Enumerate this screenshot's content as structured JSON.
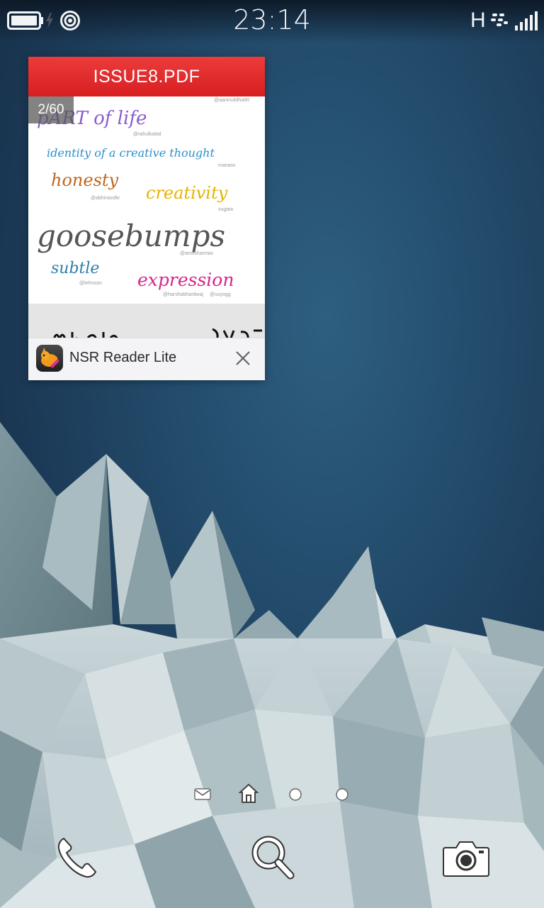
{
  "status_bar": {
    "clock": "23:14",
    "network_type": "H",
    "icons": [
      "battery-icon",
      "charging-icon",
      "hotspot-icon",
      "blackberry-icon",
      "signal-icon"
    ]
  },
  "active_frame": {
    "title": "ISSUE8.PDF",
    "page_counter": "2/60",
    "app_name": "NSR Reader Lite",
    "title_bar_color": "#e02a2b",
    "preview": {
      "words": [
        {
          "text": "pART of life",
          "color": "#8a5bd1"
        },
        {
          "text": "identity of a creative thought",
          "color": "#2a8fc9"
        },
        {
          "text": "honesty",
          "color": "#c0661a"
        },
        {
          "text": "creativity",
          "color": "#e5b400"
        },
        {
          "text": "goosebumps",
          "color": "#555555"
        },
        {
          "text": "subtle",
          "color": "#2d7ea6"
        },
        {
          "text": "expression",
          "color": "#d9248a"
        }
      ],
      "credits": [
        "@aaniruddha90",
        "@rahulkattal",
        "manasv",
        "@abhinavdkr",
        "sugata",
        "@amitsharmax",
        "@lefroson",
        "@harshabhardwaj",
        "@suyogg"
      ]
    }
  },
  "page_indicator": {
    "items": [
      "hub-icon",
      "home-icon",
      "page-dot",
      "page-dot"
    ]
  },
  "dock": {
    "items": [
      "phone-icon",
      "search-icon",
      "camera-icon"
    ]
  }
}
